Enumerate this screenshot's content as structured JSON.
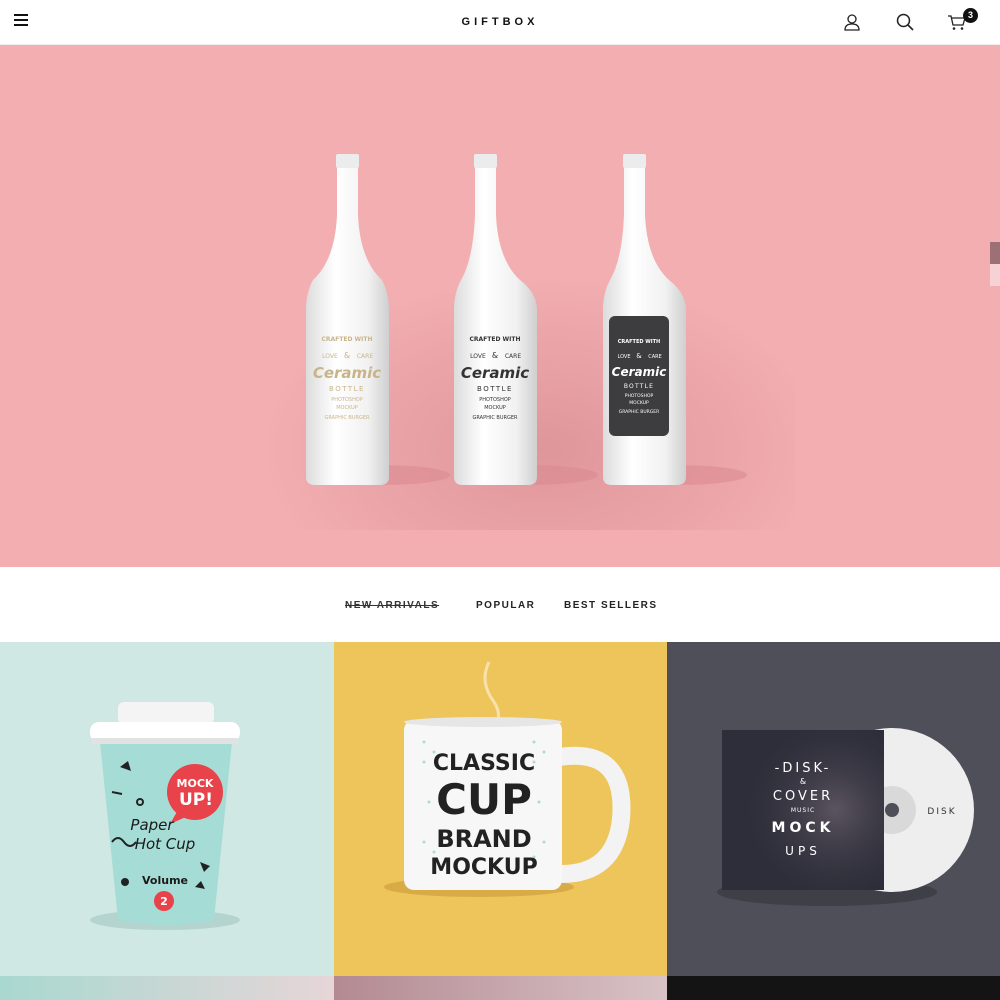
{
  "header": {
    "logo": "GIFTBOX",
    "cart_count": "3",
    "icons": [
      "menu-icon",
      "user-icon",
      "search-icon",
      "cart-icon"
    ]
  },
  "hero": {
    "bottle_label": {
      "line1": "CRAFTED WITH",
      "line2a": "LOVE",
      "amp": "&",
      "line2b": "CARE",
      "title": "Ceramic",
      "subtitle": "BOTTLE",
      "line4": "PHOTOSHOP",
      "line5": "MOCKUP",
      "line6": "GRAPHIC BURGER"
    },
    "colors": {
      "background": "#f2aeb1"
    }
  },
  "tabs": [
    {
      "label": "NEW ARRIVALS",
      "active": true
    },
    {
      "label": "POPULAR",
      "active": false
    },
    {
      "label": "BEST SELLERS",
      "active": false
    }
  ],
  "products": [
    {
      "art": {
        "mock": "MOCK",
        "up": "UP!",
        "paper": "Paper",
        "hotcup": "Hot Cup",
        "volume": "Volume",
        "num": "2"
      }
    },
    {
      "art": {
        "line1": "CLASSIC",
        "line2": "CUP",
        "line3": "BRAND",
        "line4": "MOCKUP"
      }
    },
    {
      "art": {
        "line1": "-DISK-",
        "line2": "&",
        "line3": "COVER",
        "line4": "MUSIC",
        "line5": "MOCK",
        "line6": "UPS",
        "disc": "DISK"
      }
    }
  ]
}
